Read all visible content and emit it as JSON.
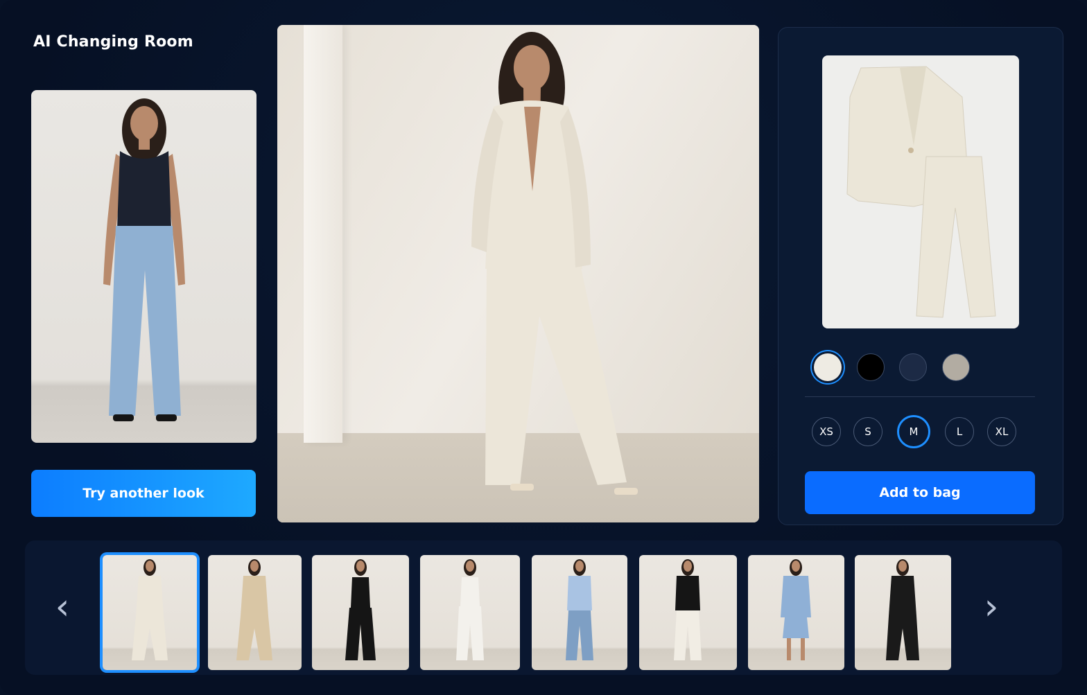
{
  "app": {
    "title": "AI Changing Room"
  },
  "user_photo": {
    "alt": "Model in black tank top and light blue jeans",
    "top_color": "#1c2230",
    "bottom_color": "#8fb0d2"
  },
  "main_preview": {
    "alt": "Model wearing cream suit",
    "outfit_color": "#ece6d9"
  },
  "buttons": {
    "try_another": "Try another look",
    "add_to_bag": "Add to bag"
  },
  "product": {
    "alt": "Cream blazer and trousers",
    "color": "#ebe6d8"
  },
  "colors": [
    {
      "name": "cream",
      "hex": "#eeebe3",
      "selected": true
    },
    {
      "name": "black",
      "hex": "#000000",
      "selected": false
    },
    {
      "name": "navy",
      "hex": "#1c2a45",
      "selected": false
    },
    {
      "name": "taupe",
      "hex": "#b2aca2",
      "selected": false
    }
  ],
  "sizes": [
    {
      "label": "XS",
      "selected": false
    },
    {
      "label": "S",
      "selected": false
    },
    {
      "label": "M",
      "selected": true
    },
    {
      "label": "L",
      "selected": false
    },
    {
      "label": "XL",
      "selected": false
    }
  ],
  "carousel": {
    "prev_icon": "chevron-left-icon",
    "next_icon": "chevron-right-icon",
    "looks": [
      {
        "name": "cream-suit",
        "top": "#ece6d9",
        "bottom": "#ece6d9",
        "selected": true
      },
      {
        "name": "beige-suit",
        "top": "#d9c6a5",
        "bottom": "#d9c6a5",
        "selected": false
      },
      {
        "name": "black-tank-wide-pants",
        "top": "#151515",
        "bottom": "#151515",
        "selected": false
      },
      {
        "name": "white-tank-trousers",
        "top": "#f3f1ec",
        "bottom": "#f3f1ec",
        "selected": false
      },
      {
        "name": "blue-shirt-jeans",
        "top": "#a9c3e3",
        "bottom": "#7e9fc4",
        "selected": false
      },
      {
        "name": "black-top-white-pants",
        "top": "#151515",
        "bottom": "#f1ede4",
        "selected": false
      },
      {
        "name": "blue-blazer-skirt",
        "top": "#8fb0d6",
        "bottom": "#8fb0d6",
        "selected": false
      },
      {
        "name": "black-suit",
        "top": "#1a1a1a",
        "bottom": "#1a1a1a",
        "selected": false
      }
    ]
  }
}
